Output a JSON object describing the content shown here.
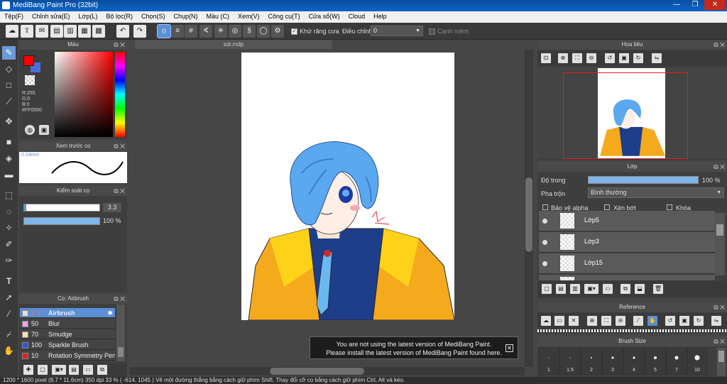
{
  "window": {
    "title": "MediBang Paint Pro (32bit)",
    "minimize": "—",
    "maximize": "❐",
    "close": "✕"
  },
  "menu": [
    "Tệp(F)",
    "Chỉnh sửa(E)",
    "Lớp(L)",
    "Bộ lọc(R)",
    "Chọn(S)",
    "Chụp(N)",
    "Màu (C)",
    "Xem(V)",
    "Công cụ(T)",
    "Cửa sổ(W)",
    "Cloud",
    "Help"
  ],
  "toolbar": {
    "antialias_label": "Khử răng cưa",
    "adjust_label": "Điều chỉnh",
    "adjust_value": "0",
    "smooth_label": "Cạnh mềm"
  },
  "color_panel": {
    "title": "Màu",
    "r": "R:255",
    "g": "G:0",
    "b": "B:0",
    "hex": "#FF0000",
    "primary": "#ff0000",
    "secondary": "#4a6ed6"
  },
  "preview_panel": {
    "title": "Xem trước cọ",
    "size": "0.24mm"
  },
  "control_panel": {
    "title": "Kiểm soát cọ",
    "size": "3.3",
    "opacity": "100 %",
    "opacity_frac": 1.0
  },
  "brush_panel": {
    "title": "Cọ: Airbrush",
    "items": [
      {
        "size": "3.3",
        "name": "Airbrush",
        "color": "#e0e0e0"
      },
      {
        "size": "50",
        "name": "Blur",
        "color": "#f0a0e8"
      },
      {
        "size": "70",
        "name": "Smudge",
        "color": "#f8e0b8"
      },
      {
        "size": "100",
        "name": "Sparkle Brush",
        "color": "#3050e0"
      },
      {
        "size": "10",
        "name": "Rotation Symmetry Pen",
        "color": "#e02020"
      }
    ]
  },
  "document": {
    "tab": "sdr.mdp"
  },
  "navigator": {
    "title": "Hoa tiêu"
  },
  "layer_panel": {
    "title": "Lớp",
    "opacity_label": "Độ trong",
    "opacity_value": "100 %",
    "opacity_frac": 1.0,
    "blend_label": "Pha trộn",
    "blend_value": "Bình thường",
    "protect_alpha": "Bảo vệ alpha",
    "clip": "Xén bớt",
    "lock": "Khóa",
    "layers": [
      "Lớp5",
      "Lớp3",
      "Lớp15"
    ]
  },
  "reference_panel": {
    "title": "Reference"
  },
  "brush_size_panel": {
    "title": "Brush Size",
    "sizes": [
      "1",
      "1.5",
      "2",
      "3",
      "4",
      "5",
      "7",
      "10"
    ]
  },
  "notification": {
    "line1": "You are not using the latest version of MediBang Paint.",
    "line2": "Please install the latest version of MediBang Paint found here."
  },
  "status": "1200 * 1600 pixel   (8.7 * 11.6cm)   350 dpi   33 %   ( -614, 1045 )   Vẽ một đường thẳng bằng cách giữ phím Shift. Thay đổi cỡ cọ bằng cách giữ phím Ctrl, Alt và kéo."
}
